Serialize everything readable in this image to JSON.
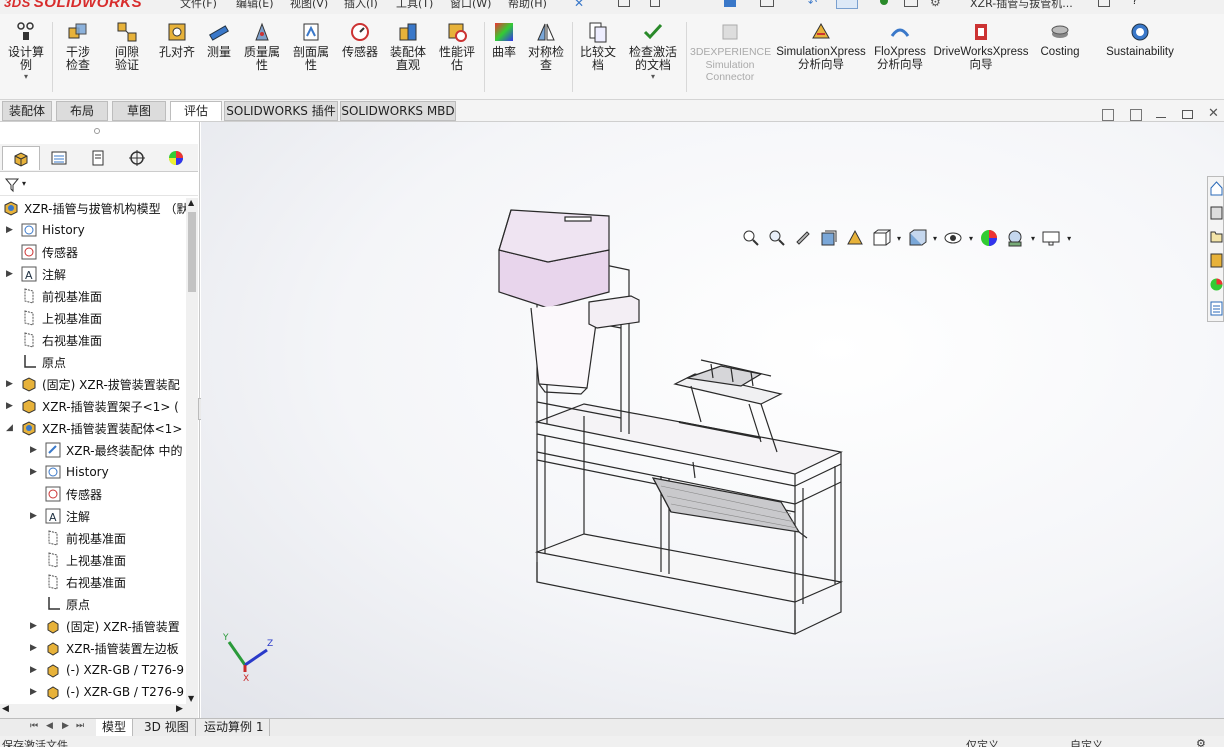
{
  "app": {
    "brand": "SOLIDWORKS",
    "ds": "3DS",
    "title": "XZR-插管与拔管机..."
  },
  "menu": [
    "文件(F)",
    "编辑(E)",
    "视图(V)",
    "插入(I)",
    "工具(T)",
    "窗口(W)",
    "帮助(H)"
  ],
  "ribbon": {
    "buttons": [
      {
        "label": "设计算例",
        "icon": "design-study-icon"
      },
      {
        "label": "干涉检查",
        "icon": "interference-icon"
      },
      {
        "label": "间隙验证",
        "icon": "clearance-icon"
      },
      {
        "label": "孔对齐",
        "icon": "hole-align-icon"
      },
      {
        "label": "测量",
        "icon": "measure-icon"
      },
      {
        "label": "质量属性",
        "icon": "mass-properties-icon"
      },
      {
        "label": "剖面属性",
        "icon": "section-properties-icon"
      },
      {
        "label": "传感器",
        "icon": "sensor-icon"
      },
      {
        "label": "装配体直观",
        "icon": "assembly-visualization-icon"
      },
      {
        "label": "性能评估",
        "icon": "performance-icon"
      },
      {
        "label": "曲率",
        "icon": "curvature-icon"
      },
      {
        "label": "对称检查",
        "icon": "symmetry-icon"
      },
      {
        "label": "比较文档",
        "icon": "compare-icon"
      },
      {
        "label": "检查激活的文档",
        "icon": "check-active-icon"
      },
      {
        "label": "3DEXPERIENCE Simulation Connector",
        "icon": "3dx-sim-icon"
      },
      {
        "label": "SimulationXpress 分析向导",
        "icon": "simxpress-icon"
      },
      {
        "label": "FloXpress 分析向导",
        "icon": "floxpress-icon"
      },
      {
        "label": "DriveWorksXpress 向导",
        "icon": "driveworks-icon"
      },
      {
        "label": "Costing",
        "icon": "costing-icon"
      },
      {
        "label": "Sustainability",
        "icon": "sustainability-icon"
      }
    ]
  },
  "cmdtabs": [
    "装配体",
    "布局",
    "草图",
    "评估",
    "SOLIDWORKS 插件",
    "SOLIDWORKS MBD"
  ],
  "tree": [
    {
      "label": "XZR-插管与拔管机构模型 （默",
      "icon": "assembly-icon"
    },
    {
      "label": "History",
      "icon": "history-icon"
    },
    {
      "label": "传感器",
      "icon": "sensor-icon"
    },
    {
      "label": "注解",
      "icon": "annotation-icon"
    },
    {
      "label": "前视基准面",
      "icon": "plane-icon"
    },
    {
      "label": "上视基准面",
      "icon": "plane-icon"
    },
    {
      "label": "右视基准面",
      "icon": "plane-icon"
    },
    {
      "label": "原点",
      "icon": "origin-icon"
    },
    {
      "label": "(固定) XZR-拔管装置装配",
      "icon": "assembly-icon"
    },
    {
      "label": "XZR-插管装置架子<1> (",
      "icon": "assembly-icon"
    },
    {
      "label": "XZR-插管装置装配体<1>",
      "icon": "assembly-icon"
    },
    {
      "label": "XZR-最终装配体 中的",
      "icon": "part-icon"
    },
    {
      "label": "History",
      "icon": "history-icon"
    },
    {
      "label": "传感器",
      "icon": "sensor-icon"
    },
    {
      "label": "注解",
      "icon": "annotation-icon"
    },
    {
      "label": "前视基准面",
      "icon": "plane-icon"
    },
    {
      "label": "上视基准面",
      "icon": "plane-icon"
    },
    {
      "label": "右视基准面",
      "icon": "plane-icon"
    },
    {
      "label": "原点",
      "icon": "origin-icon"
    },
    {
      "label": "(固定) XZR-插管装置",
      "icon": "part-icon"
    },
    {
      "label": "XZR-插管装置左边板",
      "icon": "part-icon"
    },
    {
      "label": "(-) XZR-GB / T276-9",
      "icon": "part-icon"
    },
    {
      "label": "(-) XZR-GB / T276-9",
      "icon": "part-icon"
    }
  ],
  "bottomtabs": [
    "模型",
    "3D 视图",
    "运动算例 1"
  ],
  "status": {
    "left": "保存激活文件",
    "mid": "仅定义",
    "right": "自定义"
  },
  "triad": {
    "x": "X",
    "y": "Y",
    "z": "Z"
  },
  "colors": {
    "accent": "#d82c2c",
    "brand": "#d82c2c",
    "hopper": "#e8d5ec",
    "frame": "#333333"
  }
}
